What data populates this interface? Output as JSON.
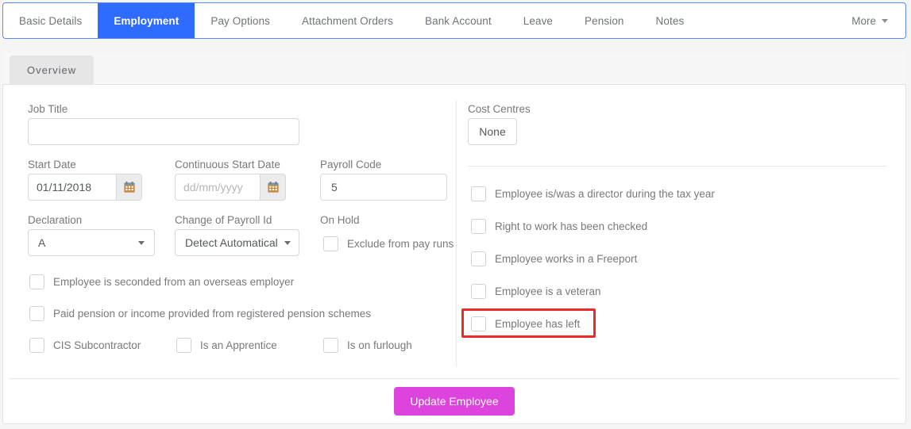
{
  "tabs": [
    {
      "label": "Basic Details",
      "active": false
    },
    {
      "label": "Employment",
      "active": true
    },
    {
      "label": "Pay Options",
      "active": false
    },
    {
      "label": "Attachment Orders",
      "active": false
    },
    {
      "label": "Bank Account",
      "active": false
    },
    {
      "label": "Leave",
      "active": false
    },
    {
      "label": "Pension",
      "active": false
    },
    {
      "label": "Notes",
      "active": false
    }
  ],
  "more_label": "More",
  "subtab": {
    "label": "Overview"
  },
  "left": {
    "job_title": {
      "label": "Job Title",
      "value": "",
      "placeholder": ""
    },
    "start_date": {
      "label": "Start Date",
      "value": "01/11/2018",
      "placeholder": "dd/mm/yyyy",
      "icon": "calendar-icon"
    },
    "continuous_start_date": {
      "label": "Continuous Start Date",
      "value": "",
      "placeholder": "dd/mm/yyyy",
      "icon": "calendar-icon"
    },
    "payroll_code": {
      "label": "Payroll Code",
      "value": "5",
      "placeholder": ""
    },
    "declaration": {
      "label": "Declaration",
      "value": "A"
    },
    "change_of_payroll_id": {
      "label": "Change of Payroll Id",
      "value": "Detect Automatical"
    },
    "on_hold": {
      "label": "On Hold",
      "checkbox_label": "Exclude from pay runs",
      "checked": false
    },
    "checkboxes": [
      {
        "label": "Employee is seconded from an overseas employer",
        "checked": false
      },
      {
        "label": "Paid pension or income provided from registered pension schemes",
        "checked": false
      }
    ],
    "checkboxes_row": [
      {
        "label": "CIS Subcontractor",
        "checked": false
      },
      {
        "label": "Is an Apprentice",
        "checked": false
      },
      {
        "label": "Is on furlough",
        "checked": false
      }
    ]
  },
  "right": {
    "cost_centres": {
      "label": "Cost Centres",
      "value": "None"
    },
    "checkboxes": [
      {
        "label": "Employee is/was a director during the tax year",
        "checked": false,
        "highlighted": false
      },
      {
        "label": "Right to work has been checked",
        "checked": false,
        "highlighted": false
      },
      {
        "label": "Employee works in a Freeport",
        "checked": false,
        "highlighted": false
      },
      {
        "label": "Employee is a veteran",
        "checked": false,
        "highlighted": false
      },
      {
        "label": "Employee has left",
        "checked": false,
        "highlighted": true
      }
    ]
  },
  "footer": {
    "update_label": "Update Employee"
  },
  "colors": {
    "active_tab": "#2f6bff",
    "primary_button": "#dd44dd",
    "highlight": "#ee2b2b",
    "border": "#d6d8db"
  }
}
